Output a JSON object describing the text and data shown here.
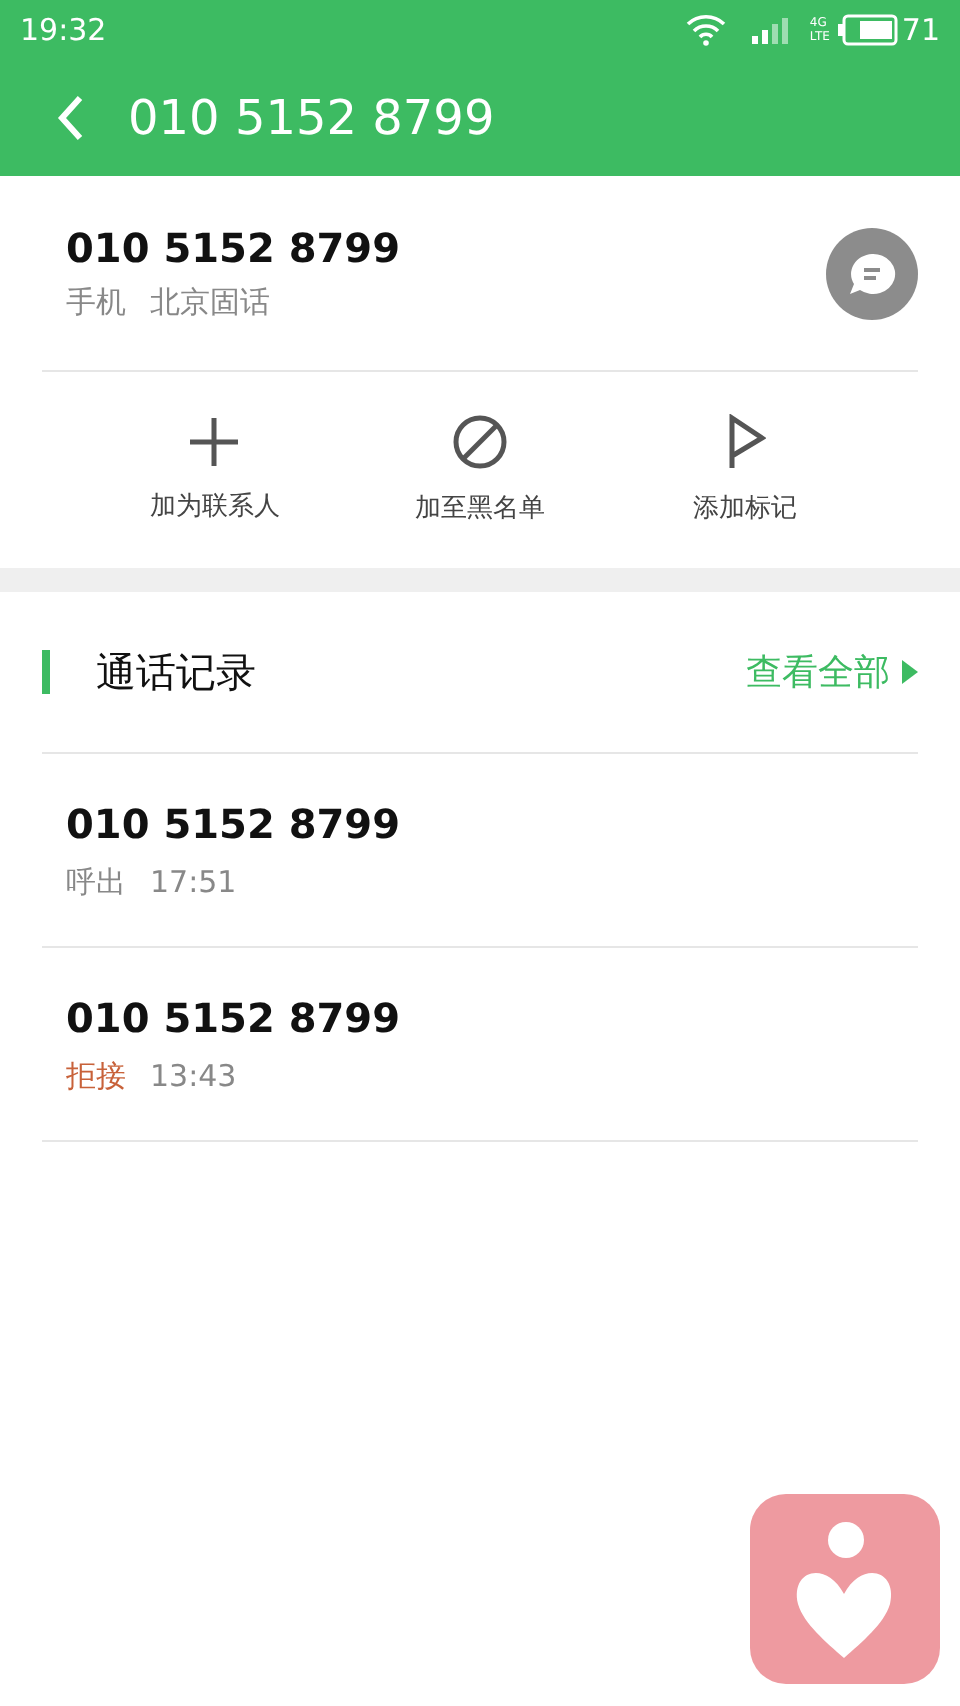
{
  "status_bar": {
    "time": "19:32",
    "network": [
      "4G",
      "LTE"
    ],
    "battery": "71"
  },
  "app_bar": {
    "title": "010 5152 8799"
  },
  "contact": {
    "number": "010 5152 8799",
    "type": "手机",
    "location": "北京固话"
  },
  "actions": [
    {
      "kind": "add",
      "label": "加为联系人"
    },
    {
      "kind": "block",
      "label": "加至黑名单"
    },
    {
      "kind": "flag",
      "label": "添加标记"
    }
  ],
  "call_log": {
    "title": "通话记录",
    "view_all": "查看全部",
    "calls": [
      {
        "number": "010 5152 8799",
        "kind": "outgoing",
        "status": "呼出",
        "time": "17:51"
      },
      {
        "number": "010 5152 8799",
        "kind": "rejected",
        "status": "拒接",
        "time": "13:43"
      }
    ]
  }
}
